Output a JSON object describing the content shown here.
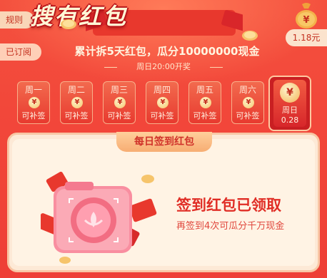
{
  "header": {
    "rules_label": "规则",
    "subscribed_label": "已订阅",
    "balance": "1.18元",
    "title": "搜有红包",
    "subtitle": "累计拆5天红包，瓜分10000000现金",
    "open_time": "周日20:00开奖"
  },
  "days": [
    {
      "label": "周一",
      "status": "可补签"
    },
    {
      "label": "周二",
      "status": "可补签"
    },
    {
      "label": "周三",
      "status": "可补签"
    },
    {
      "label": "周四",
      "status": "可补签"
    },
    {
      "label": "周五",
      "status": "可补签"
    },
    {
      "label": "周六",
      "status": "可补签"
    }
  ],
  "today": {
    "label": "周日",
    "amount": "0.28"
  },
  "coin_symbol": "¥",
  "card": {
    "tab_title": "每日签到红包",
    "claimed_title": "签到红包已领取",
    "claimed_sub": "再签到4次可瓜分千万现金"
  },
  "colors": {
    "background": "#f2473a",
    "accent_text": "#e02d25",
    "card_bg": "#fff3e4"
  },
  "icons": [
    "money-bag-icon",
    "yuan-coin-icon",
    "camera-icon",
    "red-envelope-icon"
  ]
}
